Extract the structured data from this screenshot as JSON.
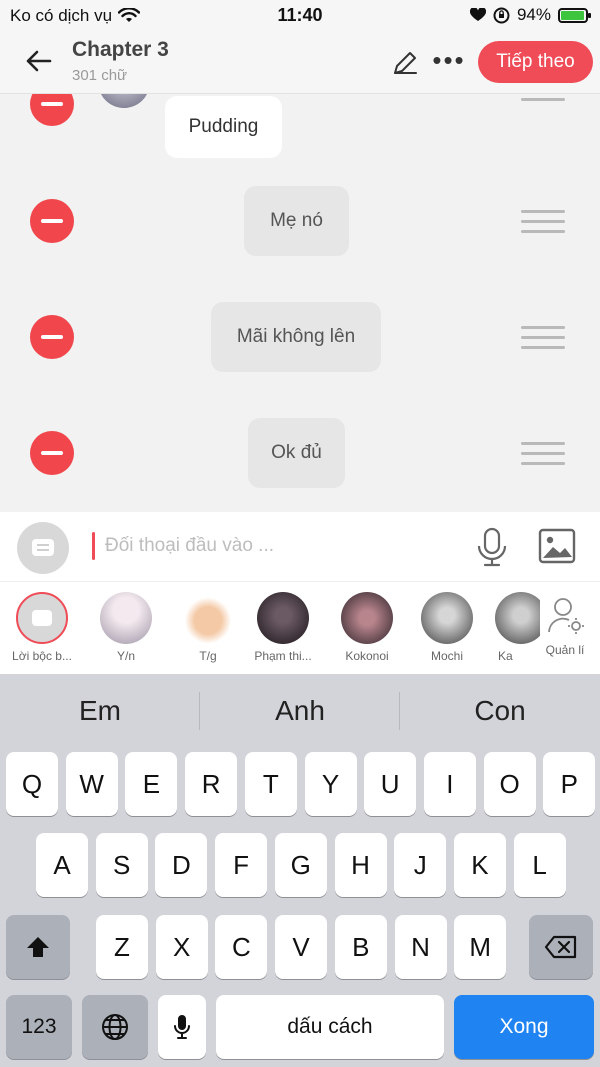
{
  "status": {
    "carrier": "Ko có dịch vụ",
    "time": "11:40",
    "battery": "94%",
    "battery_level": 0.94
  },
  "header": {
    "title": "Chapter 3",
    "subtitle": "301 chữ",
    "next_label": "Tiếp theo",
    "more_label": "•••"
  },
  "messages": [
    {
      "text": "Pudding",
      "style": "white"
    },
    {
      "text": "Mẹ nó",
      "style": "grey"
    },
    {
      "text": "Mãi không lên",
      "style": "grey"
    },
    {
      "text": "Ok đủ",
      "style": "grey"
    }
  ],
  "input": {
    "placeholder": "Đối thoại đầu vào ..."
  },
  "characters": [
    {
      "name": "Lời bộc b...",
      "selected": true
    },
    {
      "name": "Y/n"
    },
    {
      "name": "T/g"
    },
    {
      "name": "Phạm thi..."
    },
    {
      "name": "Kokonoi"
    },
    {
      "name": "Mochi"
    },
    {
      "name": "Ka"
    }
  ],
  "manage_label": "Quản lí",
  "keyboard": {
    "suggestions": [
      "Em",
      "Anh",
      "Con"
    ],
    "row1": [
      "Q",
      "W",
      "E",
      "R",
      "T",
      "Y",
      "U",
      "I",
      "O",
      "P"
    ],
    "row2": [
      "A",
      "S",
      "D",
      "F",
      "G",
      "H",
      "J",
      "K",
      "L"
    ],
    "row3": [
      "Z",
      "X",
      "C",
      "V",
      "B",
      "N",
      "M"
    ],
    "num_label": "123",
    "space_label": "dấu cách",
    "done_label": "Xong"
  }
}
